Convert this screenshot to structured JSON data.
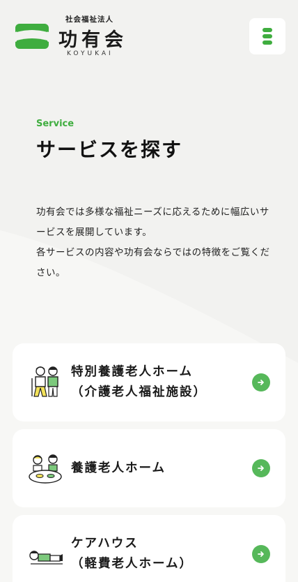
{
  "brand": {
    "subtitle": "社会福祉法人",
    "name": "功有会",
    "romanized": "KOYUKAI",
    "accent": "#3fad3f"
  },
  "header": {
    "menu_icon": "menu-icon"
  },
  "intro": {
    "eyebrow": "Service",
    "title": "サービスを探す",
    "description": [
      "功有会では多様な福祉ニーズに応えるために幅広いサービスを展開しています。",
      "各サービスの内容や功有会ならではの特徴をご覧ください。"
    ]
  },
  "services": [
    {
      "line1": "特別養護老人ホーム",
      "line2": "（介護老人福祉施設）",
      "icon": "elderly-couple-illustration"
    },
    {
      "line1": "養護老人ホーム",
      "line2": "",
      "icon": "people-eating-illustration"
    },
    {
      "line1": "ケアハウス",
      "line2": "（軽費老人ホーム）",
      "icon": "person-resting-illustration"
    }
  ],
  "arrow_icon": "arrow-right-icon"
}
